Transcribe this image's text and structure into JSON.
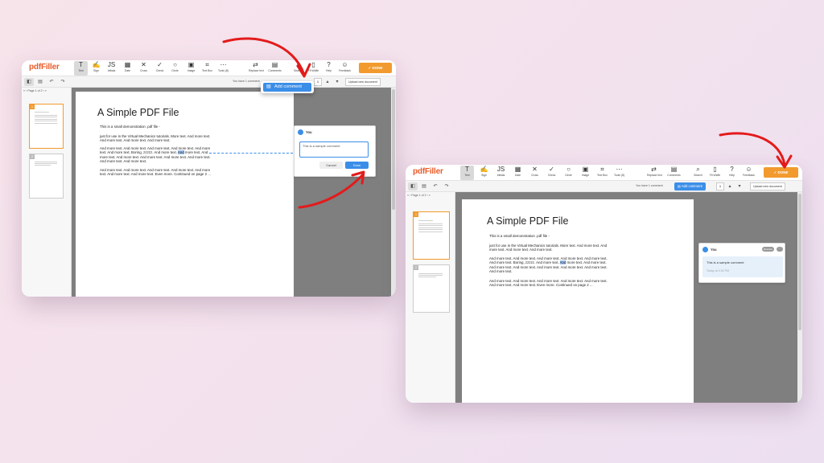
{
  "app": {
    "logo": "pdfFiller",
    "done_label": "✓ DONE",
    "tools": [
      {
        "label": "Text",
        "icon": "T"
      },
      {
        "label": "Sign",
        "icon": "✍"
      },
      {
        "label": "Initials",
        "icon": "JS"
      },
      {
        "label": "Date",
        "icon": "▦"
      },
      {
        "label": "Cross",
        "icon": "✕"
      },
      {
        "label": "Check",
        "icon": "✓"
      },
      {
        "label": "Circle",
        "icon": "○"
      },
      {
        "label": "Image",
        "icon": "▣"
      },
      {
        "label": "Text Box",
        "icon": "⌗"
      },
      {
        "label": "Tools (8)",
        "icon": "⋯"
      }
    ],
    "right_tools": [
      {
        "label": "Replace text",
        "icon": "⇄"
      },
      {
        "label": "Comments",
        "icon": "▤"
      },
      {
        "label": "Search",
        "icon": "⌕"
      },
      {
        "label": "Fit Width",
        "icon": "▯"
      },
      {
        "label": "Help",
        "icon": "?"
      },
      {
        "label": "Feedback",
        "icon": "☺"
      }
    ],
    "comment_count_text": "You have 1 comment",
    "add_comment_label": "Add comment",
    "zoom_value": "1",
    "upload_label": "Upload new document",
    "page_nav": "Page 1 of 2"
  },
  "document": {
    "title": "A Simple PDF File",
    "para1": "This is a small demonstration .pdf file -",
    "para2": "just for use in the Virtual Mechanics tutorials. More text. And more text. And more text. And more text. And more text.",
    "para3_pre": "And more text. And more text. And more text. And more text. And more text. And more text. Boring, zzzzz. And more text. ",
    "para3_hl": "And",
    "para3_post": " more text. And more text. And more text. And more text. And more text. And more text. And more text. And more text.",
    "para4": "And more text. And more text. And more text. And more text. And more text. And more text. And more text. Even more. Continued on page 2 ..."
  },
  "comment": {
    "author": "You",
    "draft": "This is a sample comment",
    "cancel_label": "Cancel",
    "done_label": "Done",
    "posted_text": "This is a sample comment",
    "posted_time": "Today at 4:30 PM",
    "resolve_label": "Resolve",
    "more_label": "···"
  },
  "thumbnails": [
    "1",
    "2"
  ],
  "colors": {
    "accent": "#3b8ee8",
    "done": "#f29a2e",
    "brand": "#e95d2a",
    "arrow": "#e31b1b"
  }
}
